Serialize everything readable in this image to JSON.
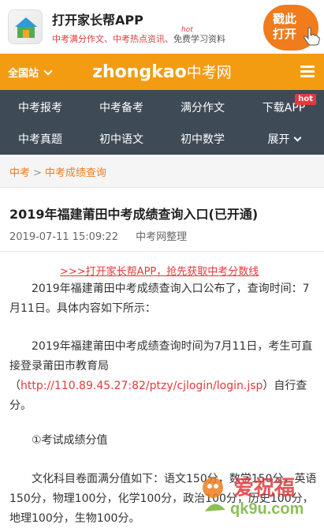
{
  "promo": {
    "title": "打开家长帮APP",
    "link1": "中考满分作文、",
    "link2": "中考热点资讯、",
    "link3": "免费学习资料",
    "hot": "hot",
    "cta_line1": "戳此",
    "cta_line2": "打开"
  },
  "header": {
    "site_label": "全国站",
    "brand_en": "zhongkao",
    "brand_cn": "中考网"
  },
  "nav": {
    "items": [
      {
        "label": "中考报考"
      },
      {
        "label": "中考备考"
      },
      {
        "label": "满分作文"
      },
      {
        "label": "下载APP",
        "badge": "hot"
      },
      {
        "label": "中考真题"
      },
      {
        "label": "初中语文"
      },
      {
        "label": "初中数学"
      },
      {
        "label": "展开"
      }
    ]
  },
  "breadcrumb": {
    "home": "中考",
    "separator": ">",
    "current": "中考成绩查询"
  },
  "article": {
    "title": "2019年福建莆田中考成绩查询入口(已开通)",
    "date": "2019-07-11 15:09:22",
    "source": "中考网整理",
    "promo_link": ">>>打开家长帮APP，抢先获取中考分数线",
    "p1": "2019年福建莆田中考成绩查询入口公布了，查询时间：7月11日。具体内容如下所示：",
    "p2_before": "2019年福建莆田中考成绩查询时间为7月11日，考生可直接登录莆田市教育局（",
    "p2_url": "http://110.89.45.27:82/ptzy/cjlogin/login.jsp",
    "p2_after": "）自行查分。",
    "section": "①考试成绩分值",
    "p3": "文化科目卷面满分值如下：语文150分，数学150分，英语150分，物理100分，化学100分，政治100分，历史100分，地理100分，生物100分。"
  },
  "watermark": {
    "text1": "爱祝福",
    "text2": "qk9u.com"
  }
}
